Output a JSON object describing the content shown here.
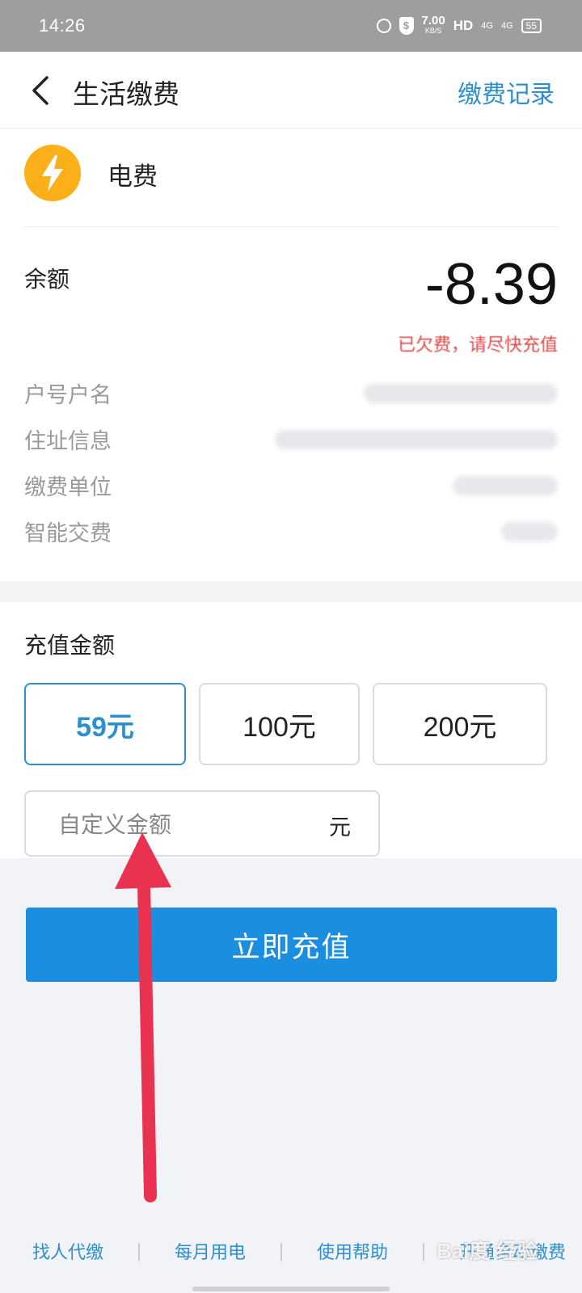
{
  "status_bar": {
    "time": "14:26",
    "speed_value": "7.00",
    "speed_unit": "KB/S",
    "hd": "HD",
    "signal1": "4G",
    "signal2": "4G",
    "battery": "55"
  },
  "nav": {
    "title": "生活缴费",
    "history_link": "缴费记录"
  },
  "bill": {
    "name": "电费",
    "balance_label": "余额",
    "balance_value": "-8.39",
    "balance_note": "已欠费，请尽快充值"
  },
  "info_rows": [
    {
      "label": "户号户名"
    },
    {
      "label": "住址信息"
    },
    {
      "label": "缴费单位"
    },
    {
      "label": "智能交费"
    }
  ],
  "recharge": {
    "title": "充值金额",
    "amounts": [
      "59元",
      "100元",
      "200元"
    ],
    "selected_index": 0,
    "custom_placeholder": "自定义金额",
    "custom_unit": "元",
    "submit_label": "立即充值"
  },
  "footer": {
    "links": [
      "找人代缴",
      "每月用电",
      "使用帮助",
      "开通自动缴费"
    ],
    "separator": "|"
  },
  "watermark": "Bai度 经验",
  "colors": {
    "accent": "#2c8fce",
    "button": "#1b8ee0",
    "warning": "#e04848",
    "bolt": "#fbb019",
    "arrow": "#e8324f"
  }
}
